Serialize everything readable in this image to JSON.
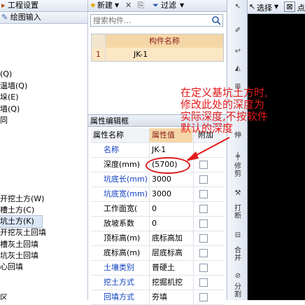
{
  "left_panel": {
    "header_top": "工程设置",
    "header_second": "绘图输入",
    "tree_items": [
      {
        "label": "(Q)",
        "selected": false
      },
      {
        "label": "温墙(Q)",
        "selected": false
      },
      {
        "label": "垛(E)",
        "selected": false
      },
      {
        "label": "墙(Q)",
        "selected": false
      },
      {
        "label": "同",
        "selected": false
      },
      {
        "label": "开挖土方(W)",
        "selected": false
      },
      {
        "label": "槽土方(C)",
        "selected": false
      },
      {
        "label": "坑土方(K)",
        "selected": true
      },
      {
        "label": "开挖灰土回填",
        "selected": false
      },
      {
        "label": "槽灰土回填",
        "selected": false
      },
      {
        "label": "坑灰土回填",
        "selected": false
      },
      {
        "label": "心回填",
        "selected": false
      },
      {
        "label": "区",
        "selected": false
      }
    ]
  },
  "middle_toolbar": {
    "new_label": "新建",
    "delete_icon": "close-icon",
    "filter_label": "过滤"
  },
  "search": {
    "placeholder": "搜索构件..."
  },
  "component_list": {
    "header": "构件名称",
    "rows": [
      {
        "index": "1",
        "name": "JK-1"
      }
    ]
  },
  "property_panel": {
    "title": "属性编辑框",
    "col_name": "属性名称",
    "col_value": "属性值",
    "col_add": "附加",
    "rows": [
      {
        "name": "名称",
        "value": "JK-1",
        "blue": true,
        "has_check": false
      },
      {
        "name": "深度(mm)",
        "value": "(5700)",
        "blue": false,
        "has_check": true
      },
      {
        "name": "坑底长(mm)",
        "value": "3000",
        "blue": true,
        "has_check": true
      },
      {
        "name": "坑底宽(mm)",
        "value": "3000",
        "blue": true,
        "has_check": true
      },
      {
        "name": "工作面宽(",
        "value": "0",
        "blue": false,
        "has_check": true
      },
      {
        "name": "放坡系数",
        "value": "0",
        "blue": false,
        "has_check": true
      },
      {
        "name": "顶标高(m)",
        "value": "底标高加",
        "blue": false,
        "has_check": true
      },
      {
        "name": "底标高(m)",
        "value": "层底标高",
        "blue": false,
        "has_check": true
      },
      {
        "name": "土壤类别",
        "value": "普硬土",
        "blue": true,
        "has_check": true
      },
      {
        "name": "挖土方式",
        "value": "挖掘机挖",
        "blue": true,
        "has_check": true
      },
      {
        "name": "回填方式",
        "value": "夯填",
        "blue": true,
        "has_check": true
      }
    ]
  },
  "right_toolbar": {
    "select_label": "选择",
    "items": [
      "伸",
      "修剪",
      "打断",
      "合并",
      "分割"
    ]
  },
  "annotation": {
    "lines": [
      "在定义基坑土方时,",
      "修改此处的深度为",
      "实际深度,不按软件",
      "默认的深度"
    ],
    "color": "#e21a1a"
  }
}
